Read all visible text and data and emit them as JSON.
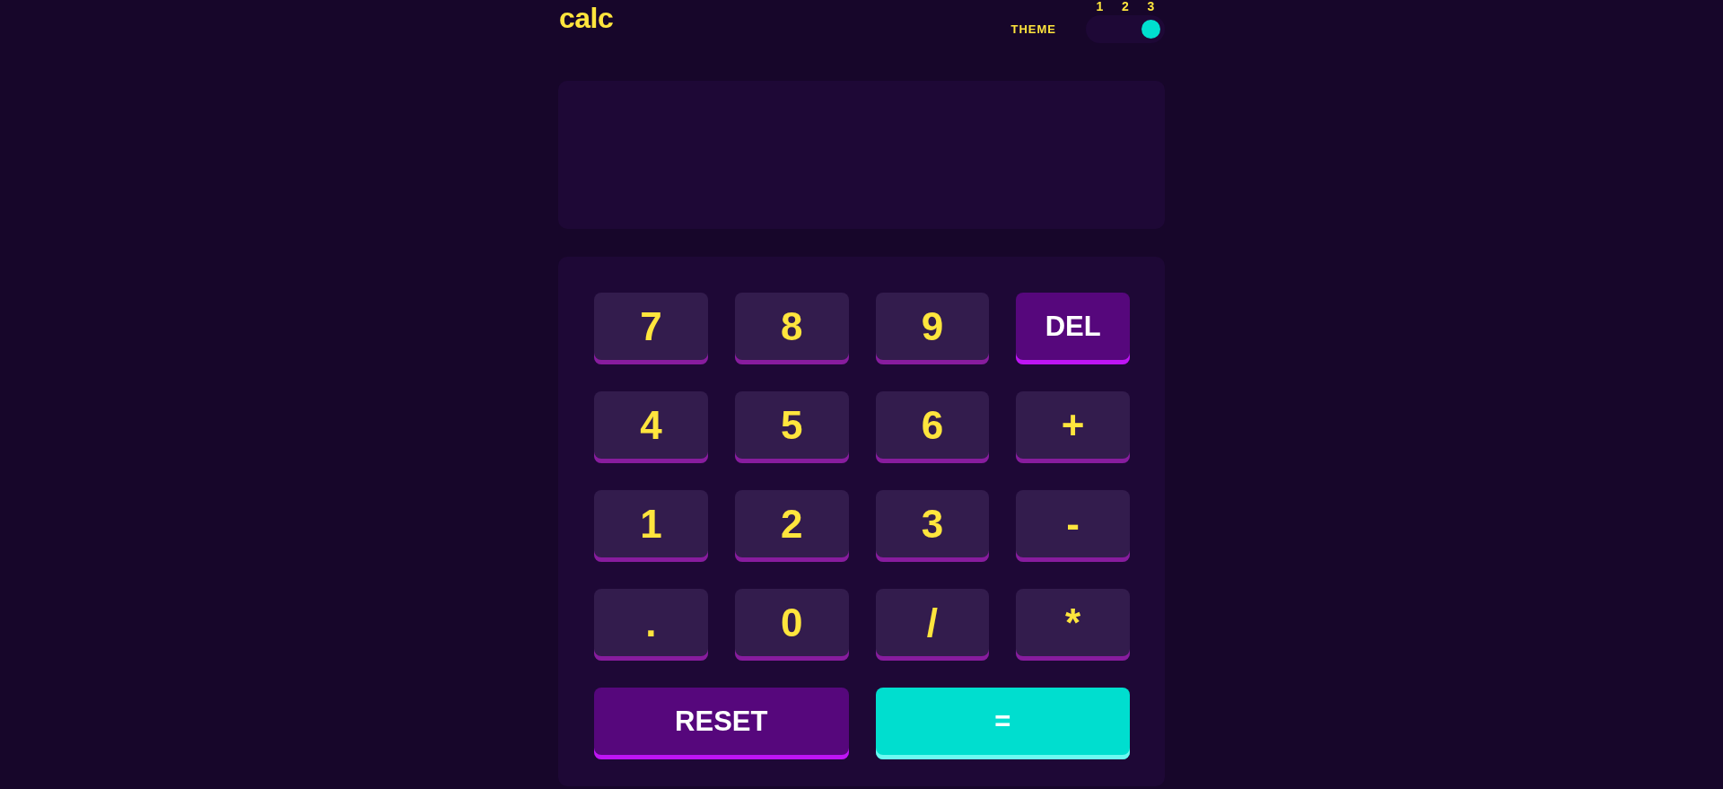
{
  "header": {
    "logo": "calc",
    "theme": {
      "label": "THEME",
      "options": [
        {
          "label": "1",
          "selected": false
        },
        {
          "label": "2",
          "selected": false
        },
        {
          "label": "3",
          "selected": true
        }
      ]
    }
  },
  "keypad": {
    "keys": [
      {
        "label": "7",
        "kind": "digit",
        "wide": false
      },
      {
        "label": "8",
        "kind": "digit",
        "wide": false
      },
      {
        "label": "9",
        "kind": "digit",
        "wide": false
      },
      {
        "label": "DEL",
        "kind": "delete",
        "wide": false
      },
      {
        "label": "4",
        "kind": "digit",
        "wide": false
      },
      {
        "label": "5",
        "kind": "digit",
        "wide": false
      },
      {
        "label": "6",
        "kind": "digit",
        "wide": false
      },
      {
        "label": "+",
        "kind": "operator",
        "wide": false
      },
      {
        "label": "1",
        "kind": "digit",
        "wide": false
      },
      {
        "label": "2",
        "kind": "digit",
        "wide": false
      },
      {
        "label": "3",
        "kind": "digit",
        "wide": false
      },
      {
        "label": "-",
        "kind": "operator",
        "wide": false
      },
      {
        "label": ".",
        "kind": "decimal",
        "wide": false
      },
      {
        "label": "0",
        "kind": "digit",
        "wide": false
      },
      {
        "label": "/",
        "kind": "operator",
        "wide": false
      },
      {
        "label": "*",
        "kind": "operator",
        "wide": false
      },
      {
        "label": "RESET",
        "kind": "reset",
        "wide": true
      },
      {
        "label": "=",
        "kind": "equals",
        "wide": true
      }
    ]
  }
}
